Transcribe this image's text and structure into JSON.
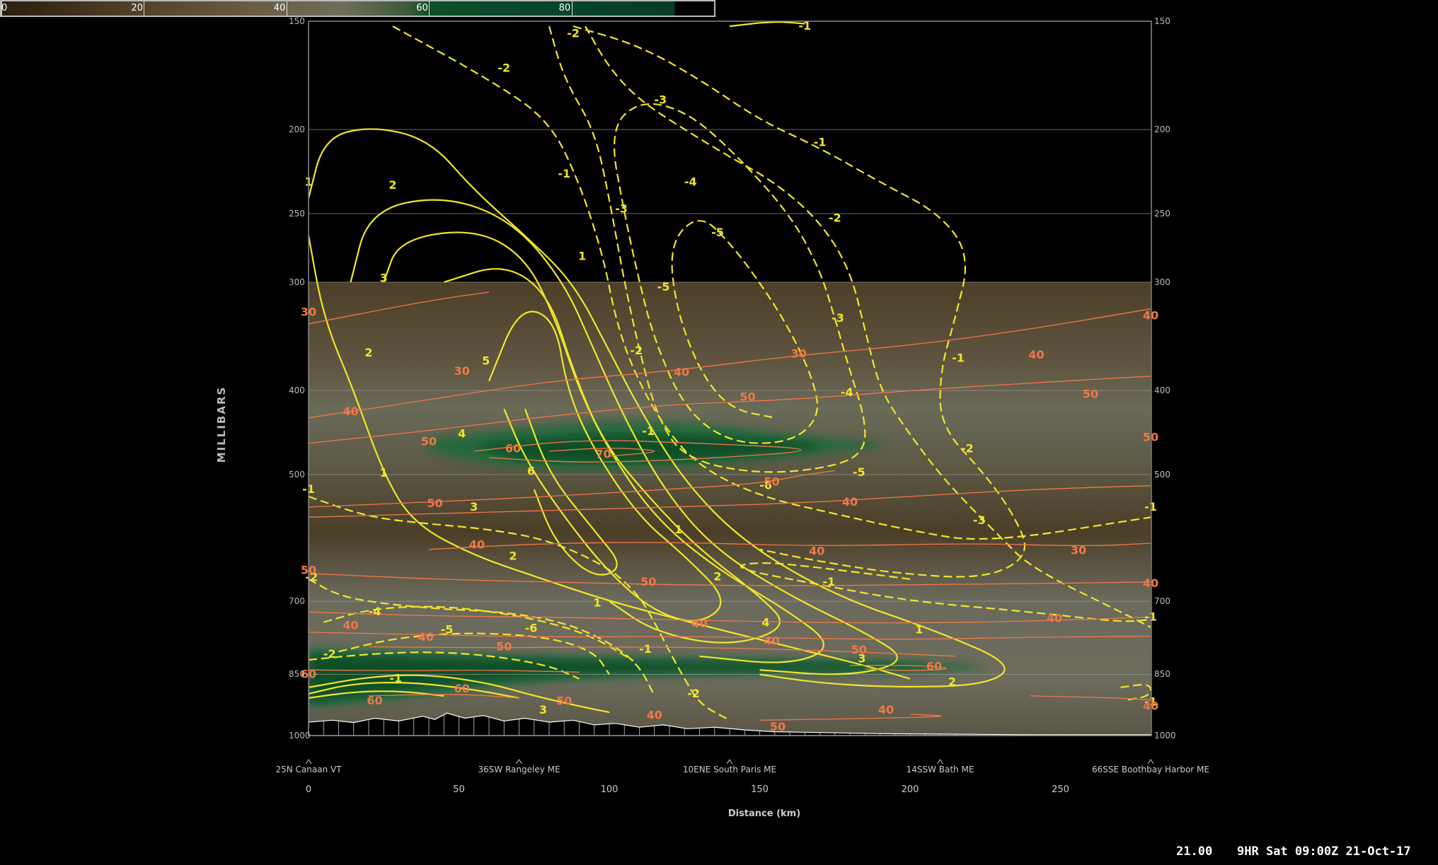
{
  "colorbar": {
    "labels": [
      "0",
      "20",
      "40",
      "60",
      "80"
    ],
    "values": [
      0,
      20,
      40,
      60,
      80
    ],
    "range": [
      0,
      100
    ]
  },
  "chart_data": {
    "type": "heatmap",
    "title": "",
    "ylabel": "MILLIBARS",
    "xlabel": "Distance (km)",
    "y_scale": "log",
    "y_ticks": [
      "150",
      "200",
      "250",
      "300",
      "400",
      "500",
      "700",
      "850",
      "1000"
    ],
    "x_ticks": [
      "0",
      "50",
      "100",
      "150",
      "200",
      "250"
    ],
    "xlim": [
      0,
      280
    ],
    "ylim_mb": [
      1000,
      150
    ],
    "stations": [
      {
        "name": "25N Canaan VT",
        "km": 0
      },
      {
        "name": "36SW Rangeley ME",
        "km": 70
      },
      {
        "name": "10ENE South Paris ME",
        "km": 140
      },
      {
        "name": "14SSW Bath ME",
        "km": 210
      },
      {
        "name": "66SSE Boothbay Harbor ME",
        "km": 280
      }
    ],
    "shaded_field_range_mb": [
      300,
      1000
    ],
    "yellow_contour_labels": [
      {
        "text": "-1",
        "km": 165,
        "mb": 152
      },
      {
        "text": "-2",
        "km": 65,
        "mb": 170
      },
      {
        "text": "-2",
        "km": 88,
        "mb": 155
      },
      {
        "text": "-3",
        "km": 117,
        "mb": 185
      },
      {
        "text": "-1",
        "km": 170,
        "mb": 207
      },
      {
        "text": "-1",
        "km": 85,
        "mb": 225
      },
      {
        "text": "-4",
        "km": 127,
        "mb": 230
      },
      {
        "text": "-3",
        "km": 104,
        "mb": 247
      },
      {
        "text": "-2",
        "km": 175,
        "mb": 253
      },
      {
        "text": "-5",
        "km": 136,
        "mb": 263
      },
      {
        "text": "-5",
        "km": 118,
        "mb": 304
      },
      {
        "text": "-3",
        "km": 176,
        "mb": 330
      },
      {
        "text": "-2",
        "km": 109,
        "mb": 360
      },
      {
        "text": "-1",
        "km": 216,
        "mb": 367
      },
      {
        "text": "-4",
        "km": 179,
        "mb": 402
      },
      {
        "text": "-1",
        "km": 113,
        "mb": 446
      },
      {
        "text": "-2",
        "km": 219,
        "mb": 467
      },
      {
        "text": "-5",
        "km": 183,
        "mb": 497
      },
      {
        "text": "-6",
        "km": 152,
        "mb": 515
      },
      {
        "text": "-1",
        "km": 0,
        "mb": 520
      },
      {
        "text": "-1",
        "km": 280,
        "mb": 545
      },
      {
        "text": "-3",
        "km": 223,
        "mb": 565
      },
      {
        "text": "-2",
        "km": 1,
        "mb": 657
      },
      {
        "text": "-1",
        "km": 173,
        "mb": 665
      },
      {
        "text": "-4",
        "km": 22,
        "mb": 720
      },
      {
        "text": "-5",
        "km": 46,
        "mb": 755
      },
      {
        "text": "-6",
        "km": 74,
        "mb": 752
      },
      {
        "text": "-1",
        "km": 280,
        "mb": 730
      },
      {
        "text": "-1",
        "km": 112,
        "mb": 795
      },
      {
        "text": "-2",
        "km": 7,
        "mb": 806
      },
      {
        "text": "-1",
        "km": 29,
        "mb": 860
      },
      {
        "text": "-2",
        "km": 128,
        "mb": 895
      },
      {
        "text": "-1",
        "km": 280,
        "mb": 915
      },
      {
        "text": "1",
        "km": 0,
        "mb": 230
      },
      {
        "text": "2",
        "km": 28,
        "mb": 232
      },
      {
        "text": "3",
        "km": 25,
        "mb": 297
      },
      {
        "text": "1",
        "km": 91,
        "mb": 280
      },
      {
        "text": "2",
        "km": 20,
        "mb": 362
      },
      {
        "text": "5",
        "km": 59,
        "mb": 370
      },
      {
        "text": "4",
        "km": 51,
        "mb": 449
      },
      {
        "text": "6",
        "km": 74,
        "mb": 496
      },
      {
        "text": "1",
        "km": 25,
        "mb": 498
      },
      {
        "text": "3",
        "km": 55,
        "mb": 545
      },
      {
        "text": "1",
        "km": 123,
        "mb": 579
      },
      {
        "text": "2",
        "km": 68,
        "mb": 621
      },
      {
        "text": "2",
        "km": 136,
        "mb": 656
      },
      {
        "text": "1",
        "km": 96,
        "mb": 703
      },
      {
        "text": "4",
        "km": 152,
        "mb": 741
      },
      {
        "text": "1",
        "km": 203,
        "mb": 755
      },
      {
        "text": "3",
        "km": 184,
        "mb": 816
      },
      {
        "text": "2",
        "km": 214,
        "mb": 868
      },
      {
        "text": "3",
        "km": 78,
        "mb": 935
      }
    ],
    "orange_contour_labels": [
      {
        "text": "30",
        "km": 0,
        "mb": 325
      },
      {
        "text": "30",
        "km": 51,
        "mb": 380
      },
      {
        "text": "30",
        "km": 163,
        "mb": 363
      },
      {
        "text": "40",
        "km": 280,
        "mb": 328
      },
      {
        "text": "40",
        "km": 14,
        "mb": 423
      },
      {
        "text": "40",
        "km": 124,
        "mb": 381
      },
      {
        "text": "40",
        "km": 242,
        "mb": 364
      },
      {
        "text": "50",
        "km": 146,
        "mb": 407
      },
      {
        "text": "50",
        "km": 260,
        "mb": 404
      },
      {
        "text": "50",
        "km": 40,
        "mb": 458
      },
      {
        "text": "50",
        "km": 280,
        "mb": 453
      },
      {
        "text": "60",
        "km": 68,
        "mb": 467
      },
      {
        "text": "70",
        "km": 98,
        "mb": 474
      },
      {
        "text": "50",
        "km": 154,
        "mb": 510
      },
      {
        "text": "40",
        "km": 180,
        "mb": 538
      },
      {
        "text": "50",
        "km": 42,
        "mb": 540
      },
      {
        "text": "30",
        "km": 256,
        "mb": 612
      },
      {
        "text": "40",
        "km": 56,
        "mb": 603
      },
      {
        "text": "40",
        "km": 169,
        "mb": 613
      },
      {
        "text": "50",
        "km": 0,
        "mb": 645
      },
      {
        "text": "50",
        "km": 113,
        "mb": 665
      },
      {
        "text": "40",
        "km": 280,
        "mb": 668
      },
      {
        "text": "40",
        "km": 130,
        "mb": 743
      },
      {
        "text": "40",
        "km": 14,
        "mb": 747
      },
      {
        "text": "40",
        "km": 39,
        "mb": 770
      },
      {
        "text": "40",
        "km": 154,
        "mb": 778
      },
      {
        "text": "40",
        "km": 248,
        "mb": 733
      },
      {
        "text": "50",
        "km": 65,
        "mb": 790
      },
      {
        "text": "50",
        "km": 183,
        "mb": 797
      },
      {
        "text": "60",
        "km": 0,
        "mb": 850
      },
      {
        "text": "60",
        "km": 208,
        "mb": 833
      },
      {
        "text": "60",
        "km": 51,
        "mb": 883
      },
      {
        "text": "60",
        "km": 22,
        "mb": 912
      },
      {
        "text": "50",
        "km": 85,
        "mb": 913
      },
      {
        "text": "40",
        "km": 115,
        "mb": 948
      },
      {
        "text": "40",
        "km": 192,
        "mb": 935
      },
      {
        "text": "40",
        "km": 280,
        "mb": 925
      },
      {
        "text": "50",
        "km": 156,
        "mb": 978
      }
    ]
  },
  "status_bar": {
    "value": "21.00",
    "valid_time": "9HR Sat 09:00Z 21-Oct-17"
  }
}
